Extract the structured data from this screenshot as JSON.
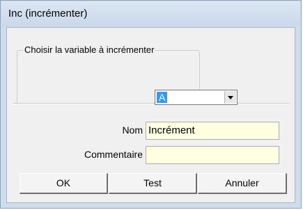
{
  "window": {
    "title": "Inc (incrémenter)"
  },
  "group": {
    "legend": "Choisir la variable à incrémenter",
    "variable_selected": "A"
  },
  "form": {
    "name_label": "Nom",
    "name_value": "Incrément",
    "comment_label": "Commentaire",
    "comment_value": ""
  },
  "buttons": {
    "ok": "OK",
    "test": "Test",
    "cancel": "Annuler"
  },
  "colors": {
    "field_background": "#ffffe1",
    "selection": "#3399ff",
    "title_bar": "#cfdceb"
  },
  "icons": {
    "dropdown": "chevron-down-icon"
  }
}
